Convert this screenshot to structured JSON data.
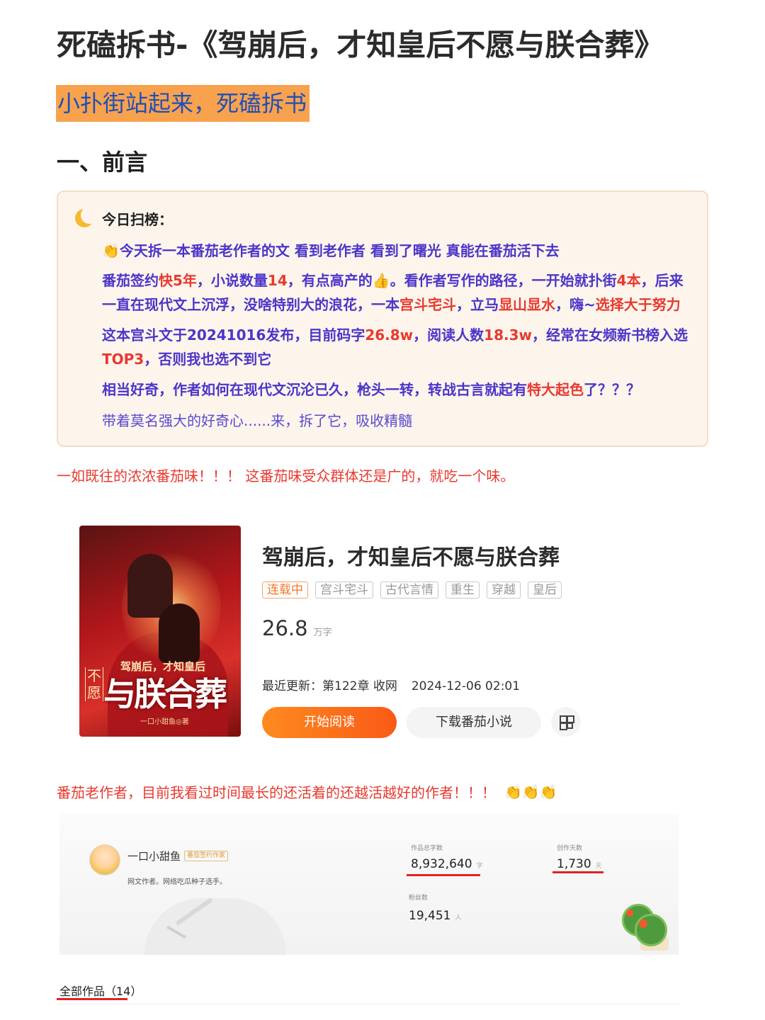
{
  "post": {
    "title": "死磕拆书-《驾崩后，才知皇后不愿与朕合葬》",
    "highlight": "小扑街站起来，死磕拆书",
    "section_heading": "一、前言"
  },
  "note": {
    "heading": "今日扫榜：",
    "icon": "moon-icon",
    "p1": "今天拆一本番茄老作者的文 看到老作者 看到了曙光 真能在番茄活下去",
    "p2a": "番茄签约",
    "p2b": "快5年",
    "p2c": "，小说数量",
    "p2d": "14",
    "p2e": "，有点高产的",
    "p2f": "。看作者写作的路径，一开始就扑街",
    "p2g": "4本",
    "p2h": "，后来一直在现代文上沉浮，没啥特别大的浪花，一本",
    "p2i": "宫斗宅斗",
    "p2j": "，立马",
    "p2k": "显山显水",
    "p2l": "，嗨~",
    "p2m": "选择大于努力",
    "p3a": "这本宫斗文于20241016发布，目前码字",
    "p3b": "26.8w",
    "p3c": "，阅读人数",
    "p3d": "18.3w",
    "p3e": "，经常在女频新书榜入选",
    "p3f": "TOP3",
    "p3g": "，否则我也选不到它",
    "p4a": "相当好奇，作者如何在现代文沉沦已久，枪头一转，转战古言就起有",
    "p4b": "特大起色",
    "p4c": "了？？？",
    "p5": "带着莫名强大的好奇心......来，拆了它，吸收精髓"
  },
  "line1": "一如既往的浓浓番茄味！！！ 这番茄味受众群体还是广的，就吃一个味。",
  "book": {
    "title": "驾崩后，才知皇后不愿与朕合葬",
    "tags": [
      "连载中",
      "宫斗宅斗",
      "古代言情",
      "重生",
      "穿越",
      "皇后"
    ],
    "word_count": "26.8",
    "word_unit": "万字",
    "update_label": "最近更新：第122章 收网",
    "update_time": "2024-12-06 02:01",
    "read_button": "开始阅读",
    "download_button": "下载番茄小说",
    "cover": {
      "small_title": "驾崩后，才知皇后",
      "big_title": "与朕合葬",
      "side": "不愿",
      "author": "一口小甜鱼◎著"
    }
  },
  "line2": "番茄老作者，目前我看过时间最长的还活着的还越活越好的作者！！！",
  "author": {
    "name": "一口小甜鱼",
    "badge": "番茄签约作家",
    "desc": "网文作者。网络吃瓜种子选手。",
    "total_words_label": "作品总字数",
    "total_words": "8,932,640",
    "total_words_unit": "字",
    "days_label": "创作天数",
    "days": "1,730",
    "days_unit": "天",
    "fans_label": "粉丝数",
    "fans": "19,451",
    "fans_unit": "人"
  },
  "tabs": {
    "all_works": "全部作品（14）"
  },
  "colors": {
    "accent": "#e8392f",
    "purple": "#4b35c9",
    "highlight_bg": "#f8a24e",
    "highlight_text": "#1f4fb8"
  }
}
